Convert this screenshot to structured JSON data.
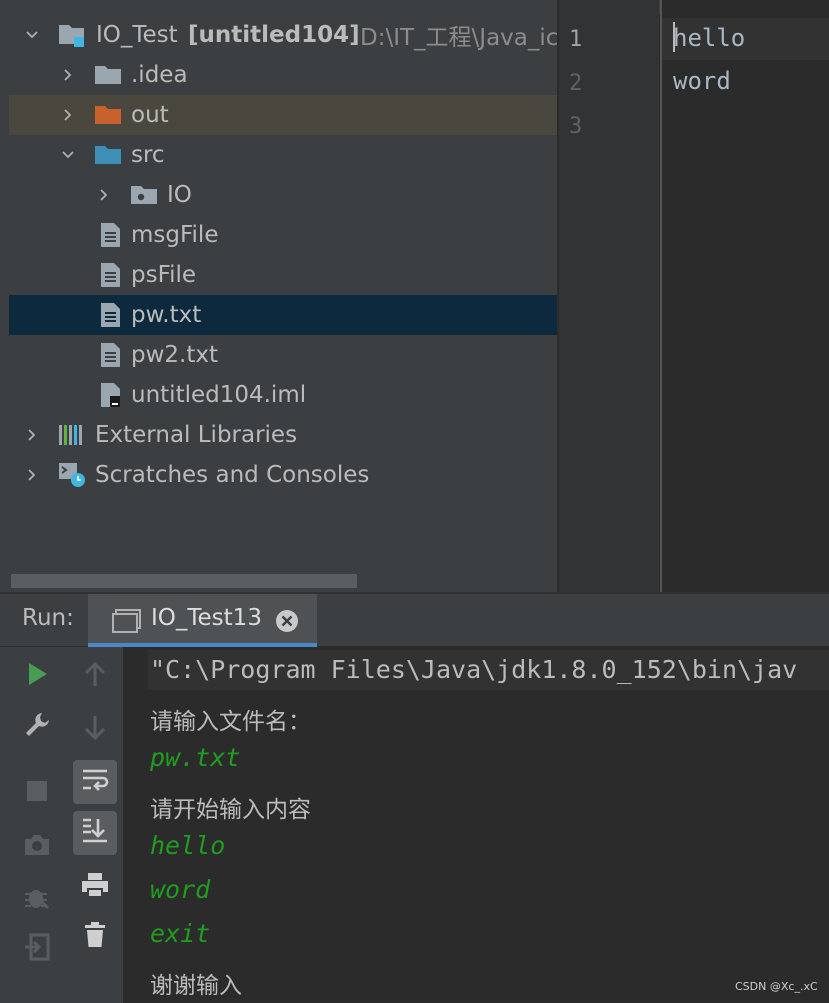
{
  "project_tree": {
    "rows": [
      {
        "label": "IO_Test",
        "module": "[untitled104]",
        "path": "D:\\IT_工程\\Java_ic"
      },
      {
        "label": ".idea"
      },
      {
        "label": "out"
      },
      {
        "label": "src"
      },
      {
        "label": "IO"
      },
      {
        "label": "msgFile"
      },
      {
        "label": "psFile"
      },
      {
        "label": "pw.txt"
      },
      {
        "label": "pw2.txt"
      },
      {
        "label": "untitled104.iml"
      },
      {
        "label": "External Libraries"
      },
      {
        "label": "Scratches and Consoles"
      }
    ]
  },
  "editor": {
    "line_numbers": [
      "1",
      "2",
      "3"
    ],
    "lines": [
      "hello",
      "word",
      ""
    ]
  },
  "run_panel": {
    "label": "Run:",
    "tab_title": "IO_Test13",
    "console": [
      {
        "text": "\"C:\\Program Files\\Java\\jdk1.8.0_152\\bin\\jav",
        "kind": "command"
      },
      {
        "text": "请输入文件名：",
        "kind": "output"
      },
      {
        "text": "pw.txt",
        "kind": "input"
      },
      {
        "text": "请开始输入内容",
        "kind": "output"
      },
      {
        "text": "hello",
        "kind": "input"
      },
      {
        "text": "word",
        "kind": "input"
      },
      {
        "text": "exit",
        "kind": "input"
      },
      {
        "text": "谢谢输入",
        "kind": "output"
      }
    ]
  },
  "icons": {
    "toolbar_left": [
      "run-icon",
      "wrench-icon",
      "stop-icon",
      "camera-icon",
      "debug-icon",
      "exit-icon"
    ],
    "toolbar_right": [
      "arrow-up-icon",
      "arrow-down-icon",
      "soft-wrap-icon",
      "scroll-to-end-icon",
      "print-icon",
      "trash-icon"
    ]
  },
  "colors": {
    "selection": "#0d293e",
    "excluded_folder_row": "#4a473f",
    "input_text": "#1f9d1f",
    "run_green": "#499c54",
    "tab_underline": "#4a88c7"
  },
  "watermark": "CSDN @Xc_.xC"
}
